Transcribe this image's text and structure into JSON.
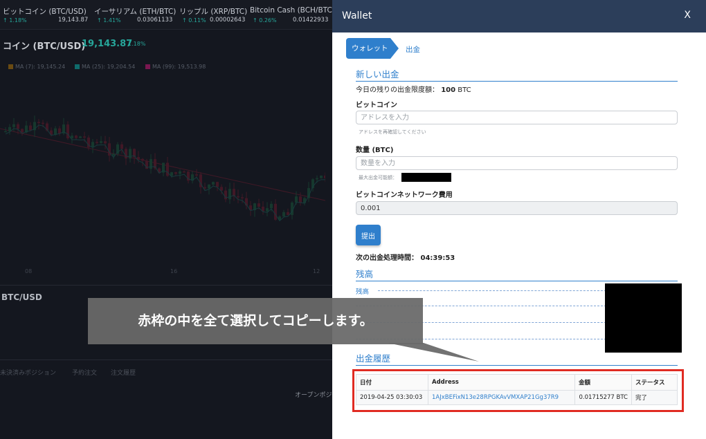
{
  "ticker": [
    {
      "name": "ビットコイン (BTC/USD)",
      "change": "↑ 1.18%",
      "price": "19,143.87"
    },
    {
      "name": "イーサリアム (ETH/BTC)",
      "change": "↑ 1.41%",
      "price": "0.03061133"
    },
    {
      "name": "リップル (XRP/BTC)",
      "change": "↑ 0.11%",
      "price": "0.00002643"
    },
    {
      "name": "Bitcoin Cash (BCH/BTC)",
      "change": "↑ 0.26%",
      "price": "0.01422933"
    }
  ],
  "chart": {
    "title": "コイン (BTC/USD)",
    "price": "19,143.87",
    "change": "1.18%",
    "ma": [
      {
        "label": "MA (7): 19,145.24",
        "color": "#6a4b12"
      },
      {
        "label": "MA (25): 19,204.54",
        "color": "#0f6b6b"
      },
      {
        "label": "MA (99): 19,513.98",
        "color": "#7a1750"
      }
    ],
    "xticks": [
      "08",
      "16",
      "12"
    ],
    "up_color": "#1e8f52",
    "down_color": "#b71c3a"
  },
  "pair_label": "BTC/USD",
  "position_tabs": [
    "未決済みポジション",
    "予約注文",
    "注文履歴"
  ],
  "open_position_label": "オープンポジ",
  "wallet": {
    "title": "Wallet",
    "close": "X",
    "breadcrumb": {
      "root": "ウォレット",
      "current": "出金"
    },
    "new_withdrawal": {
      "title": "新しい出金",
      "limit_label": "今日の残りの出金限度額：",
      "limit_value": "100",
      "limit_unit": "BTC",
      "address_label": "ビットコイン",
      "address_placeholder": "アドレスを入力",
      "address_hint": "アドレスを再確認してください",
      "amount_label": "数量 (BTC)",
      "amount_placeholder": "数量を入力",
      "amount_hint": "最大出金可能額：",
      "fee_label": "ビットコインネットワーク費用",
      "fee_value": "0.001",
      "submit": "提出",
      "next_time_label": "次の出金処理時間：",
      "next_time_value": "04:39:53"
    },
    "balance": {
      "title": "残高",
      "row_label": "残高"
    },
    "history": {
      "title": "出金履歴",
      "columns": [
        "日付",
        "Address",
        "金額",
        "ステータス"
      ],
      "rows": [
        {
          "date": "2019-04-25 03:30:03",
          "address": "1AJxBEFixN13e28RPGKAvVMXAP21Gg37R9",
          "amount": "0.01715277 BTC",
          "status": "完了"
        }
      ]
    }
  },
  "callout": {
    "text": "赤枠の中を全て選択してコピーします。"
  },
  "accent_color": "#2f7fcc",
  "highlight_color": "#e02b22"
}
